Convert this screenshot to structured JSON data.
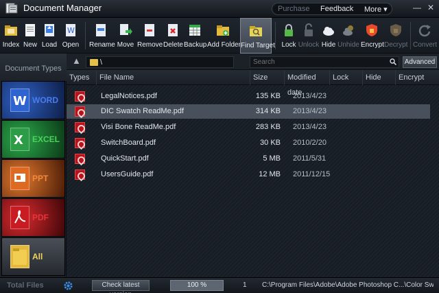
{
  "window": {
    "title": "Document Manager",
    "links": {
      "purchase": "Purchase",
      "feedback": "Feedback",
      "more": "More ▾"
    },
    "controls": {
      "minimize": "—",
      "close": "✕"
    }
  },
  "toolbar": {
    "buttons": [
      {
        "label": "Index",
        "icon": "index-folder-icon",
        "enabled": true
      },
      {
        "label": "New",
        "icon": "new-doc-icon",
        "enabled": true
      },
      {
        "label": "Load",
        "icon": "load-icon",
        "enabled": true
      },
      {
        "label": "Open",
        "icon": "open-doc-icon",
        "enabled": true
      },
      {
        "label": "Rename",
        "icon": "rename-icon",
        "enabled": true
      },
      {
        "label": "Move",
        "icon": "move-icon",
        "enabled": true
      },
      {
        "label": "Remove",
        "icon": "remove-icon",
        "enabled": true
      },
      {
        "label": "Delete",
        "icon": "delete-icon",
        "enabled": true
      },
      {
        "label": "Backup",
        "icon": "backup-icon",
        "enabled": true
      },
      {
        "label": "Add Folder",
        "icon": "add-folder-icon",
        "enabled": true
      },
      {
        "label": "Find Target",
        "icon": "find-target-icon",
        "enabled": true,
        "active": true
      },
      {
        "label": "Lock",
        "icon": "lock-icon",
        "enabled": true
      },
      {
        "label": "Unlock",
        "icon": "unlock-icon",
        "enabled": false
      },
      {
        "label": "Hide",
        "icon": "hide-cloud-icon",
        "enabled": true
      },
      {
        "label": "Unhide",
        "icon": "unhide-cloud-icon",
        "enabled": false
      },
      {
        "label": "Encrypt",
        "icon": "encrypt-shield-icon",
        "enabled": true
      },
      {
        "label": "Decrypt",
        "icon": "decrypt-shield-icon",
        "enabled": false
      },
      {
        "label": "Convert",
        "icon": "convert-icon",
        "enabled": false
      }
    ]
  },
  "sidebar": {
    "header": "Document Types",
    "categories": [
      {
        "label": "WORD",
        "color": "#3f6fd8",
        "bg": "#1a3a7a"
      },
      {
        "label": "EXCEL",
        "color": "#3fc94a",
        "bg": "#17602a"
      },
      {
        "label": "PPT",
        "color": "#e8732c",
        "bg": "#8a3c10"
      },
      {
        "label": "PDF",
        "color": "#e0282c",
        "bg": "#7a0c12"
      },
      {
        "label": "All",
        "color": "#f0c850",
        "bg": "#35393f"
      }
    ]
  },
  "pathbar": {
    "path": "\\",
    "search_placeholder": "Search",
    "advanced": "Advanced"
  },
  "table": {
    "columns": [
      "Types",
      "File Name",
      "Size",
      "Modified date",
      "Lock",
      "Hide",
      "Encrypt"
    ],
    "rows": [
      {
        "name": "LegalNotices.pdf",
        "size": "135 KB",
        "date": "2013/4/23",
        "selected": false
      },
      {
        "name": "DIC Swatch ReadMe.pdf",
        "size": "314 KB",
        "date": "2013/4/23",
        "selected": true
      },
      {
        "name": "Visi Bone ReadMe.pdf",
        "size": "283 KB",
        "date": "2013/4/23",
        "selected": false
      },
      {
        "name": "SwitchBoard.pdf",
        "size": "30 KB",
        "date": "2010/2/20",
        "selected": false
      },
      {
        "name": "QuickStart.pdf",
        "size": "5 MB",
        "date": "2011/5/31",
        "selected": false
      },
      {
        "name": "UsersGuide.pdf",
        "size": "12 MB",
        "date": "2011/12/15",
        "selected": false
      }
    ]
  },
  "status": {
    "total_files": "Total Files",
    "check_version": "Check latest version",
    "zoom": "100 %",
    "selected_count": "1",
    "path": "C:\\Program Files\\Adobe\\Adobe Photoshop C...\\Color Swatches\\"
  }
}
